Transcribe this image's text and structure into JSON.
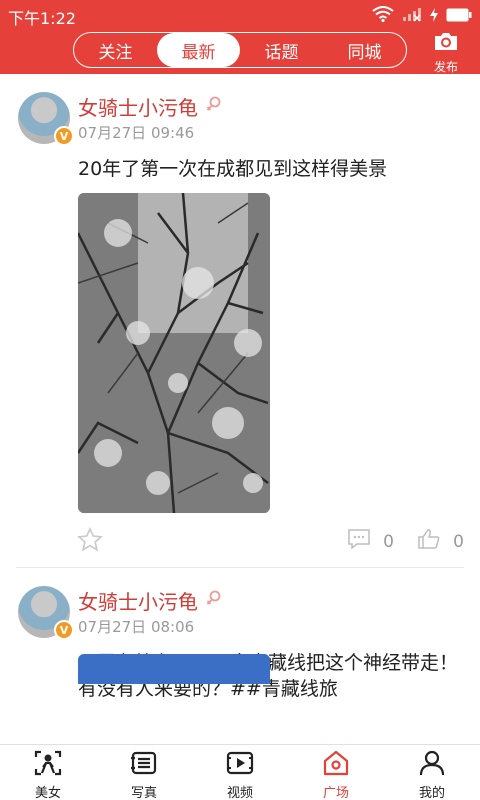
{
  "status_bar": {
    "time": "下午1:22"
  },
  "header": {
    "tabs": [
      {
        "label": "关注",
        "active": false
      },
      {
        "label": "最新",
        "active": true
      },
      {
        "label": "话题",
        "active": false
      },
      {
        "label": "同城",
        "active": false
      }
    ],
    "publish_label": "发布",
    "accent_color": "#e5403a"
  },
  "posts": [
    {
      "username": "女骑士小污龟",
      "badge": "V",
      "date": "07月27日 09:46",
      "text": "20年了第一次在成都见到这样得美景",
      "comments": "0",
      "likes": "0"
    },
    {
      "username": "女骑士小污龟",
      "badge": "V",
      "date": "07月27日 08:06",
      "text": "只需九块九，可以来青藏线把这个神经带走！有没有人来要的？##青藏线旅",
      "comments": "",
      "likes": ""
    }
  ],
  "bottom_nav": [
    {
      "label": "美女",
      "icon": "beauty-icon",
      "active": false
    },
    {
      "label": "写真",
      "icon": "photo-album-icon",
      "active": false
    },
    {
      "label": "视频",
      "icon": "video-icon",
      "active": false
    },
    {
      "label": "广场",
      "icon": "plaza-icon",
      "active": true
    },
    {
      "label": "我的",
      "icon": "profile-icon",
      "active": false
    }
  ]
}
